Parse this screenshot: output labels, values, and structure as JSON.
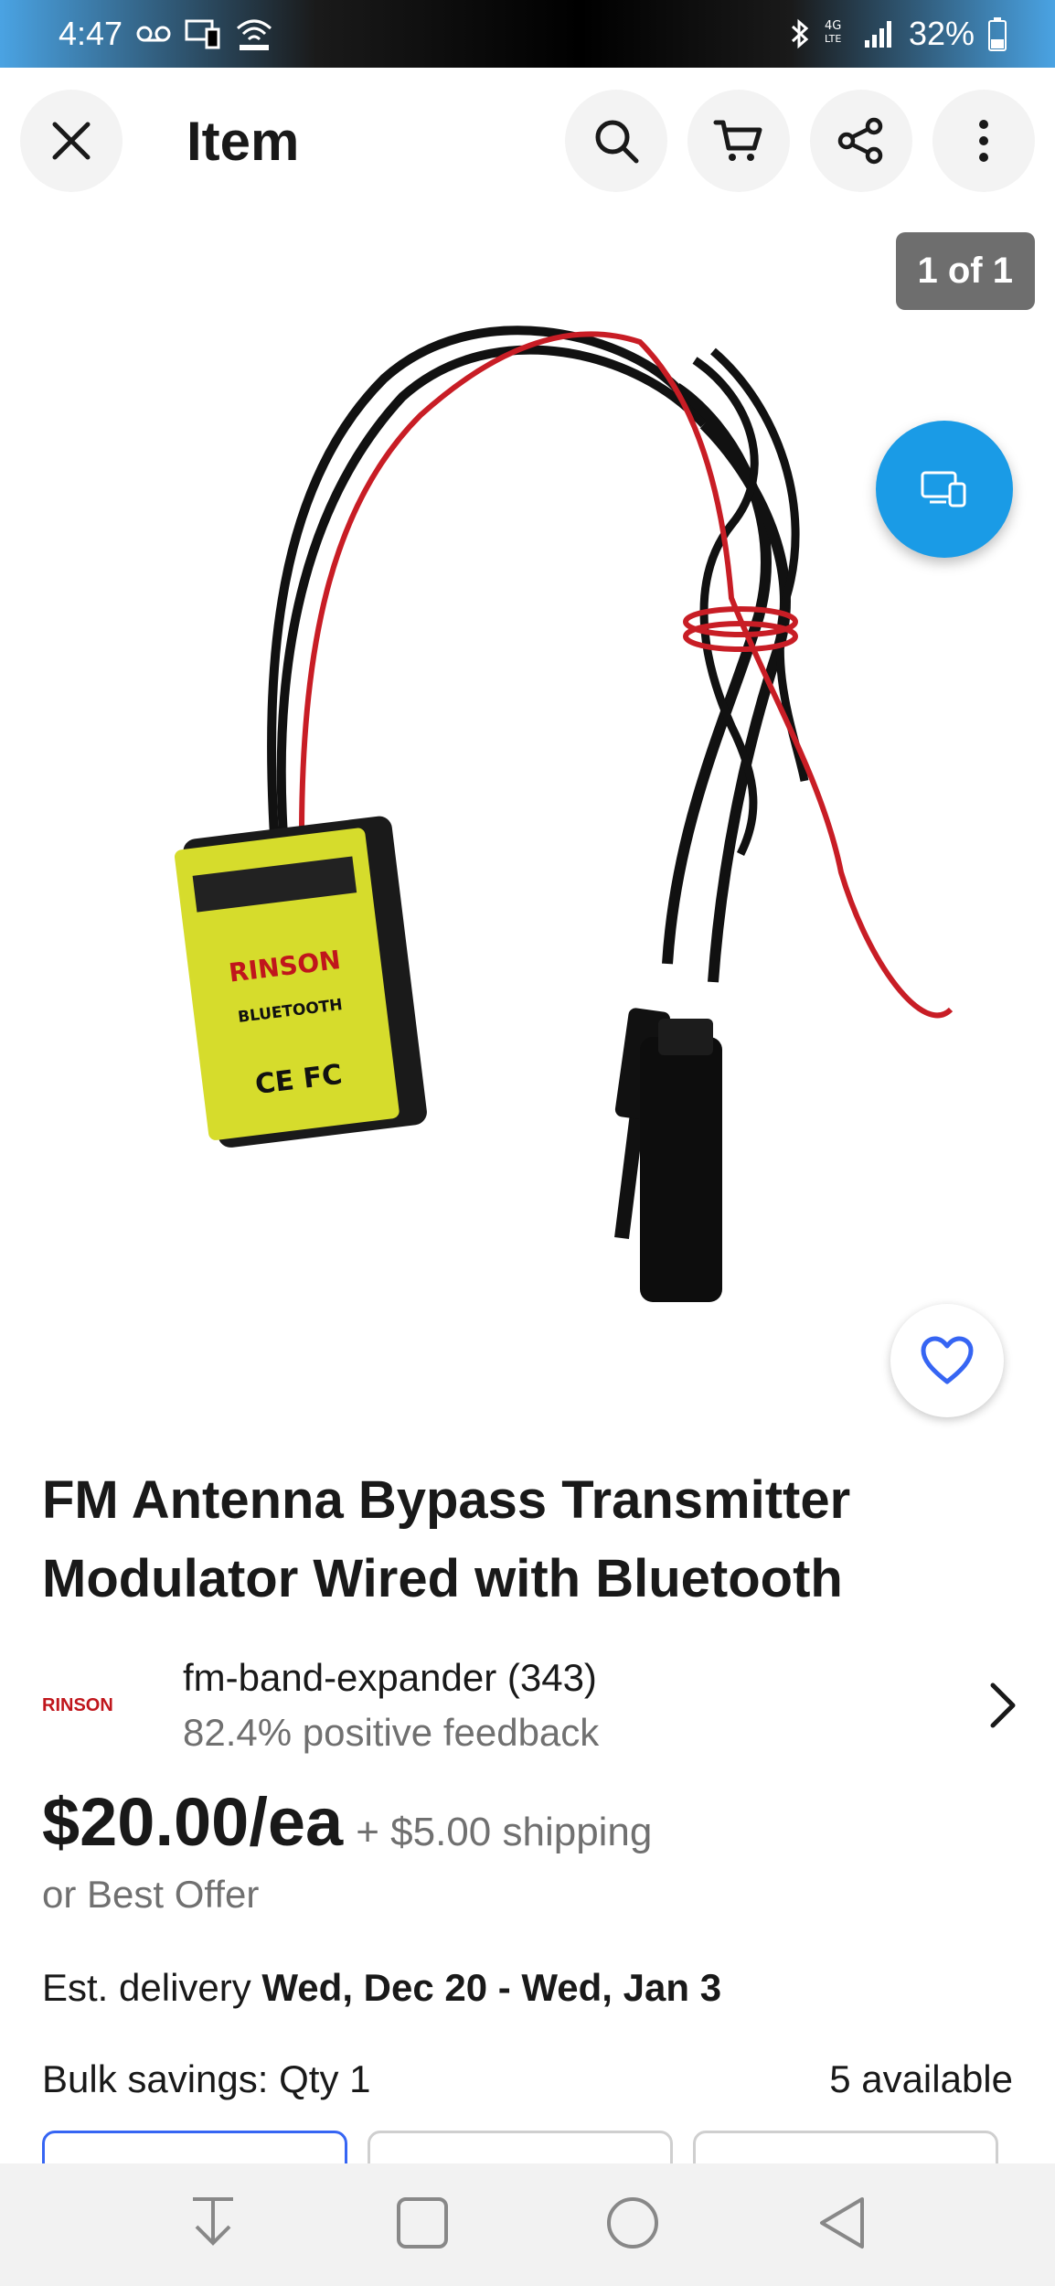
{
  "status_bar": {
    "time": "4:47",
    "battery": "32%",
    "network": "4G LTE"
  },
  "app_bar": {
    "title": "Item"
  },
  "gallery": {
    "counter": "1 of 1",
    "product_label_brand": "RINSON",
    "product_label_text": "BLUETOOTH",
    "product_label_marks": "CE FC"
  },
  "listing": {
    "title": "FM Antenna Bypass Transmitter Modulator Wired with Bluetooth",
    "seller": {
      "logo_text": "RINSON",
      "name": "fm-band-expander (343)",
      "feedback": "82.4% positive feedback"
    },
    "price": "$20.00/ea",
    "shipping": "+ $5.00 shipping",
    "best_offer": "or Best Offer",
    "delivery_label": "Est. delivery ",
    "delivery_dates": "Wed, Dec 20 - Wed, Jan 3",
    "bulk_label": "Bulk savings: Qty 1",
    "available": "5 available"
  },
  "colors": {
    "accent": "#3665f3",
    "cast_button": "#1a9be6",
    "badge": "#6e6e6e"
  }
}
